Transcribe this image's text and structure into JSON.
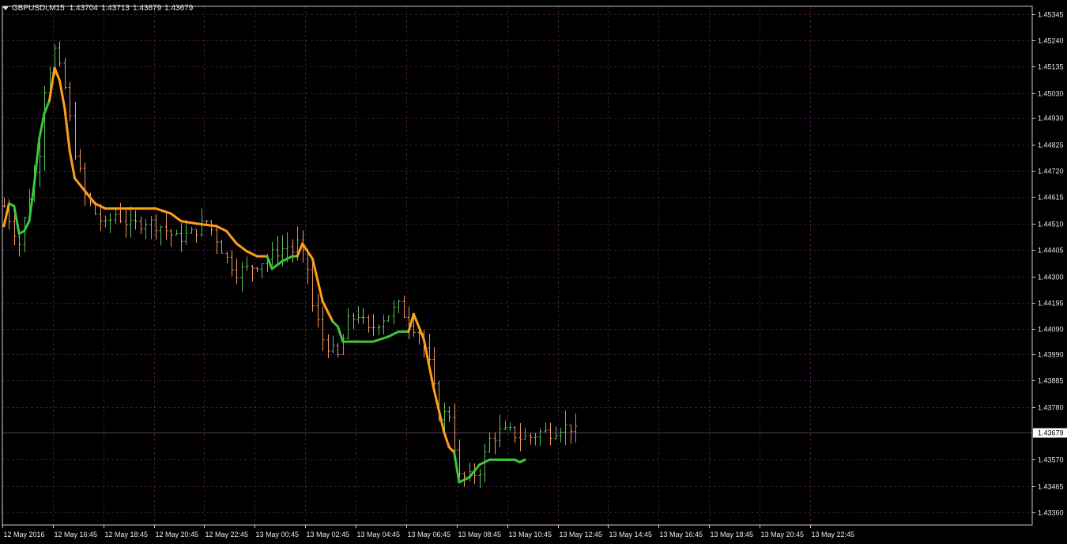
{
  "header": {
    "symbol": "GBPUSDi,M15",
    "open": "1.43704",
    "high": "1.43713",
    "low": "1.43679",
    "close": "1.43679"
  },
  "colors": {
    "background": "#000000",
    "grid": "#3d1a3d",
    "axis_text": "#e8e8e8",
    "up_bar": "#5dbe5d",
    "down_bar": "#f09860",
    "ma_up": "#3cc83c",
    "ma_down": "#ff9f1a",
    "current_price_line": "#5a3c5a"
  },
  "icons": {
    "menu": "triangle-down-icon"
  },
  "chart_data": {
    "type": "bar",
    "style": "ohlc-bars-with-colored-moving-average",
    "symbol": "GBPUSDi",
    "timeframe": "M15",
    "current_price": "1.43679",
    "ylim": [
      1.4331,
      1.45375
    ],
    "y_ticks": [
      "1.45345",
      "1.45240",
      "1.45135",
      "1.45030",
      "1.44930",
      "1.44825",
      "1.44720",
      "1.44615",
      "1.44510",
      "1.44405",
      "1.44300",
      "1.44195",
      "1.44090",
      "1.43990",
      "1.43885",
      "1.43780",
      "1.43570",
      "1.43465",
      "1.43360"
    ],
    "x_tick_labels": [
      "12 May 2016",
      "12 May 16:45",
      "12 May 18:45",
      "12 May 20:45",
      "12 May 22:45",
      "13 May 00:45",
      "13 May 02:45",
      "13 May 04:45",
      "13 May 06:45",
      "13 May 08:45",
      "13 May 10:45",
      "13 May 12:45",
      "13 May 14:45",
      "13 May 16:45",
      "13 May 18:45",
      "13 May 20:45",
      "13 May 22:45"
    ],
    "grid": true,
    "price_path": [
      [
        0,
        1.4458
      ],
      [
        3,
        1.4443
      ],
      [
        5,
        1.4462
      ],
      [
        7,
        1.448
      ],
      [
        8,
        1.4505
      ],
      [
        10,
        1.452
      ],
      [
        12,
        1.4505
      ],
      [
        14,
        1.448
      ],
      [
        16,
        1.4462
      ],
      [
        18,
        1.4455
      ],
      [
        20,
        1.445
      ],
      [
        22,
        1.4455
      ],
      [
        25,
        1.445
      ],
      [
        28,
        1.4452
      ],
      [
        31,
        1.445
      ],
      [
        34,
        1.4445
      ],
      [
        37,
        1.4447
      ],
      [
        40,
        1.4452
      ],
      [
        42,
        1.4445
      ],
      [
        44,
        1.4437
      ],
      [
        46,
        1.4432
      ],
      [
        48,
        1.4433
      ],
      [
        50,
        1.4435
      ],
      [
        52,
        1.4437
      ],
      [
        54,
        1.444
      ],
      [
        56,
        1.4442
      ],
      [
        57,
        1.444
      ],
      [
        58,
        1.4443
      ],
      [
        60,
        1.4433
      ],
      [
        61,
        1.4418
      ],
      [
        63,
        1.4405
      ],
      [
        65,
        1.44
      ],
      [
        66,
        1.4398
      ],
      [
        68,
        1.4412
      ],
      [
        70,
        1.4415
      ],
      [
        72,
        1.4408
      ],
      [
        74,
        1.4412
      ],
      [
        76,
        1.4415
      ],
      [
        78,
        1.4418
      ],
      [
        80,
        1.4412
      ],
      [
        82,
        1.4408
      ],
      [
        84,
        1.4395
      ],
      [
        86,
        1.4375
      ],
      [
        88,
        1.4375
      ],
      [
        90,
        1.435
      ],
      [
        92,
        1.435
      ],
      [
        94,
        1.4353
      ],
      [
        96,
        1.4365
      ],
      [
        98,
        1.4368
      ],
      [
        100,
        1.4368
      ],
      [
        102,
        1.4366
      ],
      [
        104,
        1.4366
      ],
      [
        106,
        1.4368
      ],
      [
        108,
        1.4368
      ],
      [
        110,
        1.437
      ],
      [
        112,
        1.437
      ],
      [
        113,
        1.43679
      ]
    ],
    "ma_series": {
      "up_color_name": "green",
      "down_color_name": "orange",
      "points": [
        [
          0,
          1.445,
          "d"
        ],
        [
          1,
          1.4459,
          "d"
        ],
        [
          2,
          1.4458,
          "u"
        ],
        [
          3,
          1.4447,
          "u"
        ],
        [
          4,
          1.4448,
          "u"
        ],
        [
          5,
          1.4452,
          "u"
        ],
        [
          6,
          1.4467,
          "u"
        ],
        [
          7,
          1.4485,
          "u"
        ],
        [
          8,
          1.4495,
          "u"
        ],
        [
          9,
          1.45,
          "u"
        ],
        [
          10,
          1.4513,
          "d"
        ],
        [
          11,
          1.4508,
          "d"
        ],
        [
          12,
          1.4497,
          "d"
        ],
        [
          13,
          1.448,
          "d"
        ],
        [
          14,
          1.4469,
          "d"
        ],
        [
          16,
          1.4464,
          "d"
        ],
        [
          18,
          1.4459,
          "d"
        ],
        [
          20,
          1.4457,
          "d"
        ],
        [
          25,
          1.4457,
          "d"
        ],
        [
          30,
          1.4457,
          "d"
        ],
        [
          33,
          1.4455,
          "d"
        ],
        [
          35,
          1.4452,
          "d"
        ],
        [
          38,
          1.4451,
          "d"
        ],
        [
          42,
          1.445,
          "d"
        ],
        [
          44,
          1.4448,
          "d"
        ],
        [
          46,
          1.4443,
          "d"
        ],
        [
          48,
          1.444,
          "d"
        ],
        [
          50,
          1.4438,
          "d"
        ],
        [
          52,
          1.4438,
          "d"
        ],
        [
          53,
          1.4433,
          "u"
        ],
        [
          55,
          1.4436,
          "u"
        ],
        [
          57,
          1.4438,
          "u"
        ],
        [
          58,
          1.4438,
          "u"
        ],
        [
          59,
          1.4443,
          "d"
        ],
        [
          61,
          1.4437,
          "d"
        ],
        [
          63,
          1.442,
          "d"
        ],
        [
          65,
          1.4412,
          "d"
        ],
        [
          66,
          1.441,
          "u"
        ],
        [
          67,
          1.4404,
          "u"
        ],
        [
          70,
          1.4404,
          "u"
        ],
        [
          73,
          1.4404,
          "u"
        ],
        [
          76,
          1.4406,
          "u"
        ],
        [
          78,
          1.4408,
          "u"
        ],
        [
          79,
          1.4408,
          "u"
        ],
        [
          80,
          1.4408,
          "u"
        ],
        [
          81,
          1.4415,
          "d"
        ],
        [
          83,
          1.4405,
          "d"
        ],
        [
          85,
          1.4385,
          "d"
        ],
        [
          87,
          1.4368,
          "d"
        ],
        [
          88,
          1.4362,
          "d"
        ],
        [
          89,
          1.436,
          "d"
        ],
        [
          90,
          1.4348,
          "u"
        ],
        [
          92,
          1.435,
          "u"
        ],
        [
          94,
          1.4355,
          "u"
        ],
        [
          96,
          1.4357,
          "u"
        ],
        [
          98,
          1.4357,
          "u"
        ],
        [
          100,
          1.4357,
          "u"
        ],
        [
          101,
          1.4357,
          "u"
        ],
        [
          102,
          1.4356,
          "u"
        ],
        [
          103,
          1.4357,
          "u"
        ]
      ]
    }
  }
}
